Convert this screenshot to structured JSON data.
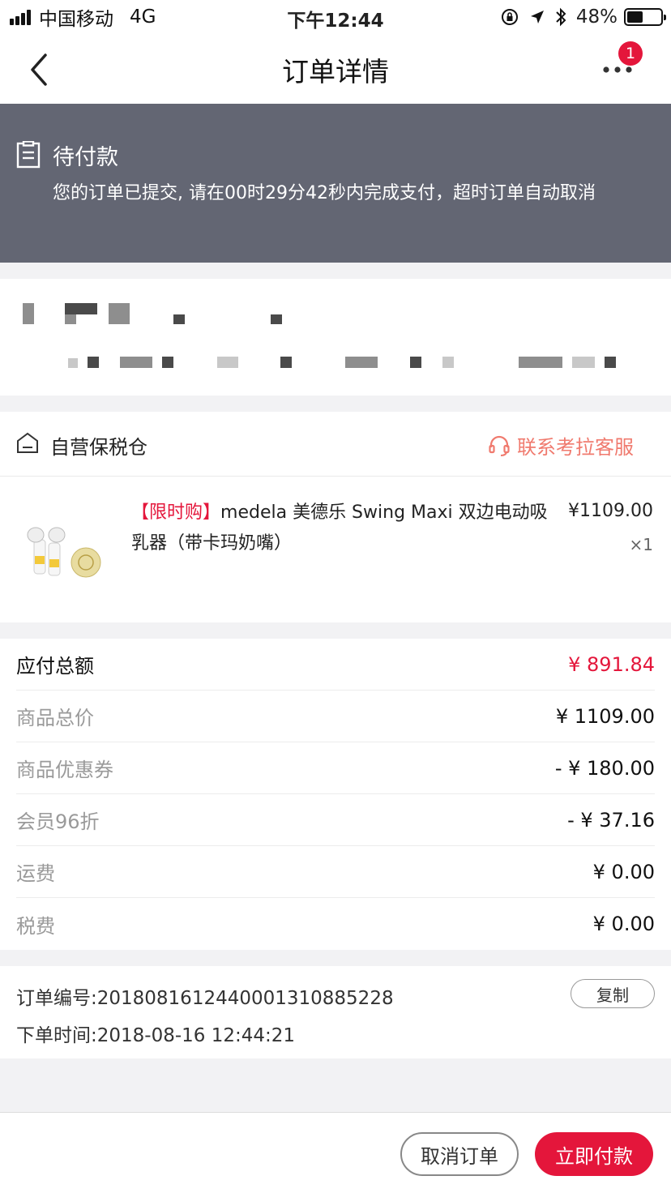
{
  "status_bar": {
    "carrier": "中国移动",
    "network": "4G",
    "time": "下午12:44",
    "battery": "48%",
    "battery_level": 0.48
  },
  "nav": {
    "title": "订单详情",
    "more_badge": "1"
  },
  "order_status": {
    "title": "待付款",
    "message": "您的订单已提交, 请在00时29分42秒内完成支付，超时订单自动取消"
  },
  "shop": {
    "name": "自营保税仓",
    "contact_label": "联系考拉客服"
  },
  "product": {
    "tag": "【限时购】",
    "name": "medela 美德乐 Swing Maxi 双边电动吸乳器（带卡玛奶嘴）",
    "price": "¥1109.00",
    "quantity": "×1"
  },
  "price_summary": {
    "rows": [
      {
        "label": "应付总额",
        "value": "¥ 891.84"
      },
      {
        "label": "商品总价",
        "value": "¥ 1109.00"
      },
      {
        "label": "商品优惠券",
        "value": "- ¥ 180.00"
      },
      {
        "label": "会员96折",
        "value": "- ¥ 37.16"
      },
      {
        "label": "运费",
        "value": "¥ 0.00"
      },
      {
        "label": "税费",
        "value": "¥ 0.00"
      }
    ]
  },
  "order_info": {
    "order_number": "订单编号:2018081612440001310885228",
    "order_time": "下单时间:2018-08-16 12:44:21",
    "copy_label": "复制"
  },
  "actions": {
    "cancel_label": "取消订单",
    "pay_label": "立即付款"
  },
  "colors": {
    "accent": "#e4163b",
    "banner": "#636673",
    "link": "#f07a6e"
  }
}
